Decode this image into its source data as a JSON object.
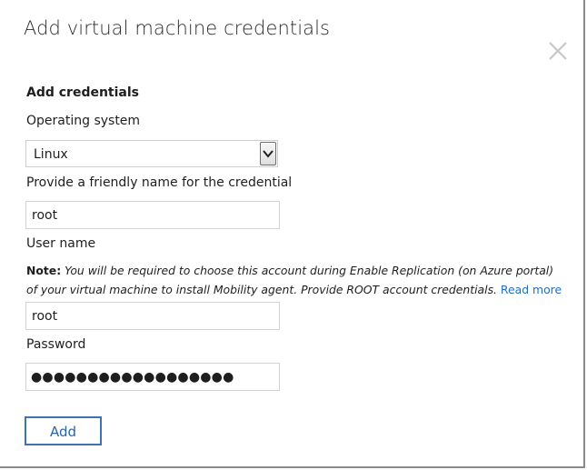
{
  "dialog": {
    "title": "Add virtual machine credentials",
    "close_icon": "close-icon"
  },
  "form": {
    "section_title": "Add credentials",
    "os_label": "Operating system",
    "os_value": "Linux",
    "friendly_name_label": "Provide a friendly name for the credential",
    "friendly_name_value": "root",
    "username_label": "User name",
    "note_label": "Note:",
    "note_text": "You will be required to choose this account during Enable Replication (on Azure portal) of your virtual machine to install Mobility agent. Provide ROOT account credentials.",
    "read_more": "Read more",
    "username_value": "root",
    "password_label": "Password",
    "password_masked": "●●●●●●●●●●●●●●●●●●",
    "add_button": "Add"
  },
  "colors": {
    "accent": "#3b75b8",
    "link": "#1f6fc2",
    "border": "#d2d2d2",
    "close_icon": "#c8c8c8"
  }
}
